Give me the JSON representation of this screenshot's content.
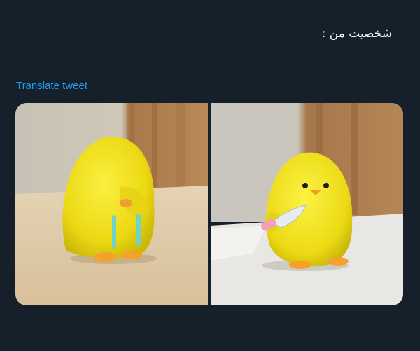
{
  "tweet": {
    "text": "شخصیت من :",
    "translate_label": "Translate tweet"
  },
  "media": [
    {
      "icon": "sad-yellow-chick-plush-photo"
    },
    {
      "icon": "yellow-chick-plush-with-knife-photo"
    }
  ],
  "colors": {
    "background": "#15202b",
    "text": "#f5f8fa",
    "link": "#1d9bf0",
    "chick_yellow": "#f2e21a"
  }
}
